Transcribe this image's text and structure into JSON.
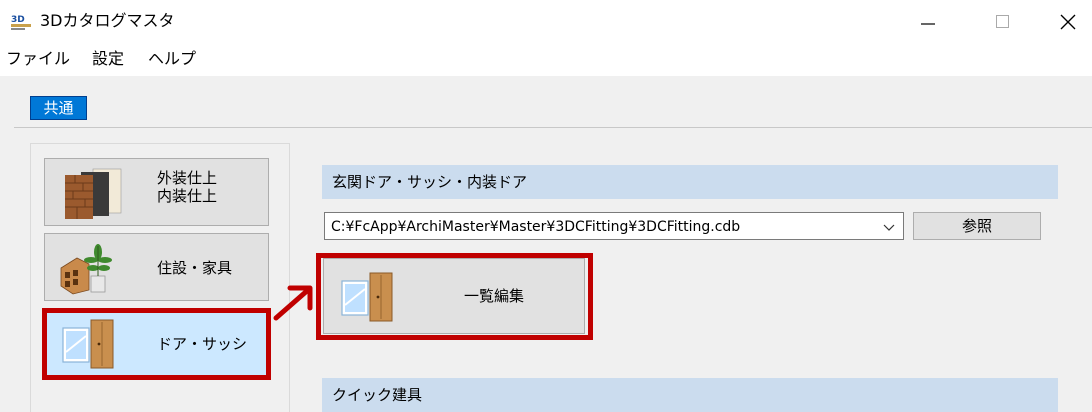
{
  "window": {
    "title": "3Dカタログマスタ",
    "app_icon": "3d-catalog-icon",
    "controls": [
      "minimize-icon",
      "maximize-icon",
      "close-icon"
    ]
  },
  "menu": [
    "ファイル",
    "設定",
    "ヘルプ"
  ],
  "tabs": [
    {
      "label": "共通",
      "selected": true
    }
  ],
  "categories": [
    {
      "label_line1": "外装仕上",
      "label_line2": "内装仕上",
      "icon": "wall-materials-icon",
      "selected": false
    },
    {
      "label": "住設・家具",
      "icon": "furniture-plant-icon",
      "selected": false
    },
    {
      "label": "ドア・サッシ",
      "icon": "door-window-icon",
      "selected": true
    }
  ],
  "door_section": {
    "header": "玄関ドア・サッシ・内装ドア",
    "path": "C:¥FcApp¥ArchiMaster¥Master¥3DCFitting¥3DCFitting.cdb",
    "browse_label": "参照",
    "list_edit_label": "一覧編集"
  },
  "quick_section": {
    "header": "クイック建具"
  },
  "colors": {
    "accent": "#0078d7",
    "highlight": "#c00000",
    "section_header": "#cbdcee"
  }
}
